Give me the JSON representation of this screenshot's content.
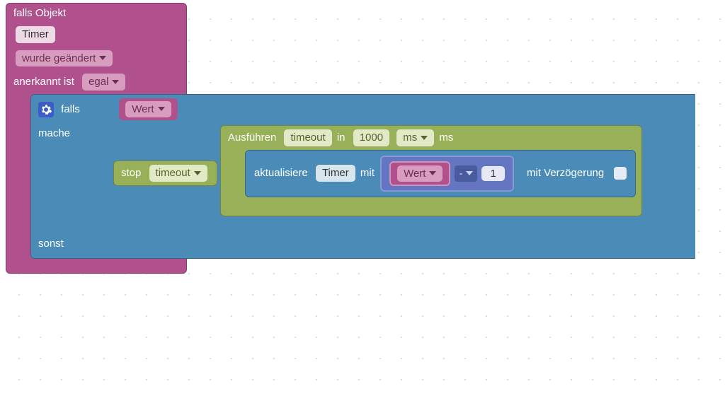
{
  "outer": {
    "header": "falls Objekt",
    "object_name": "Timer",
    "trigger": "wurde geändert",
    "ack_label": "anerkannt ist",
    "ack_value": "egal",
    "else_label": "sonst"
  },
  "if_block": {
    "if_label": "falls",
    "do_label": "mache",
    "condition_value": "Wert"
  },
  "stop_block": {
    "label": "stop",
    "target": "timeout"
  },
  "exec_block": {
    "label": "Ausführen",
    "name": "timeout",
    "in_label": "in",
    "delay_value": "1000",
    "unit": "ms",
    "unit_suffix": "ms"
  },
  "update_block": {
    "label": "aktualisiere",
    "target": "Timer",
    "with_label": "mit",
    "with_delay_label": "mit Verzögerung"
  },
  "expr": {
    "left_value": "Wert",
    "op": "-",
    "right_value": "1"
  },
  "chart_data": null
}
